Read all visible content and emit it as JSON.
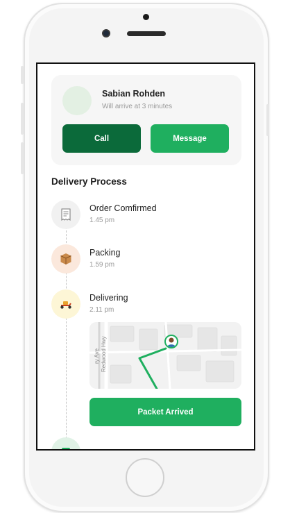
{
  "driver": {
    "name": "Sabian Rohden",
    "eta": "Will arrive at 3 minutes",
    "call_label": "Call",
    "message_label": "Message"
  },
  "delivery": {
    "title": "Delivery Process",
    "steps": [
      {
        "title": "Order Comfirmed",
        "time": "1.45 pm",
        "icon": "receipt-icon"
      },
      {
        "title": "Packing",
        "time": "1.59 pm",
        "icon": "package-icon"
      },
      {
        "title": "Delivering",
        "time": "2.11 pm",
        "icon": "scooter-icon"
      }
    ]
  },
  "map": {
    "road_labels": [
      "Redwood Hwy",
      "ry Ave"
    ]
  },
  "packet_arrived_label": "Packet Arrived",
  "colors": {
    "primary_dark": "#0b6a3a",
    "primary": "#1faf5f",
    "route": "#1faf5f"
  }
}
